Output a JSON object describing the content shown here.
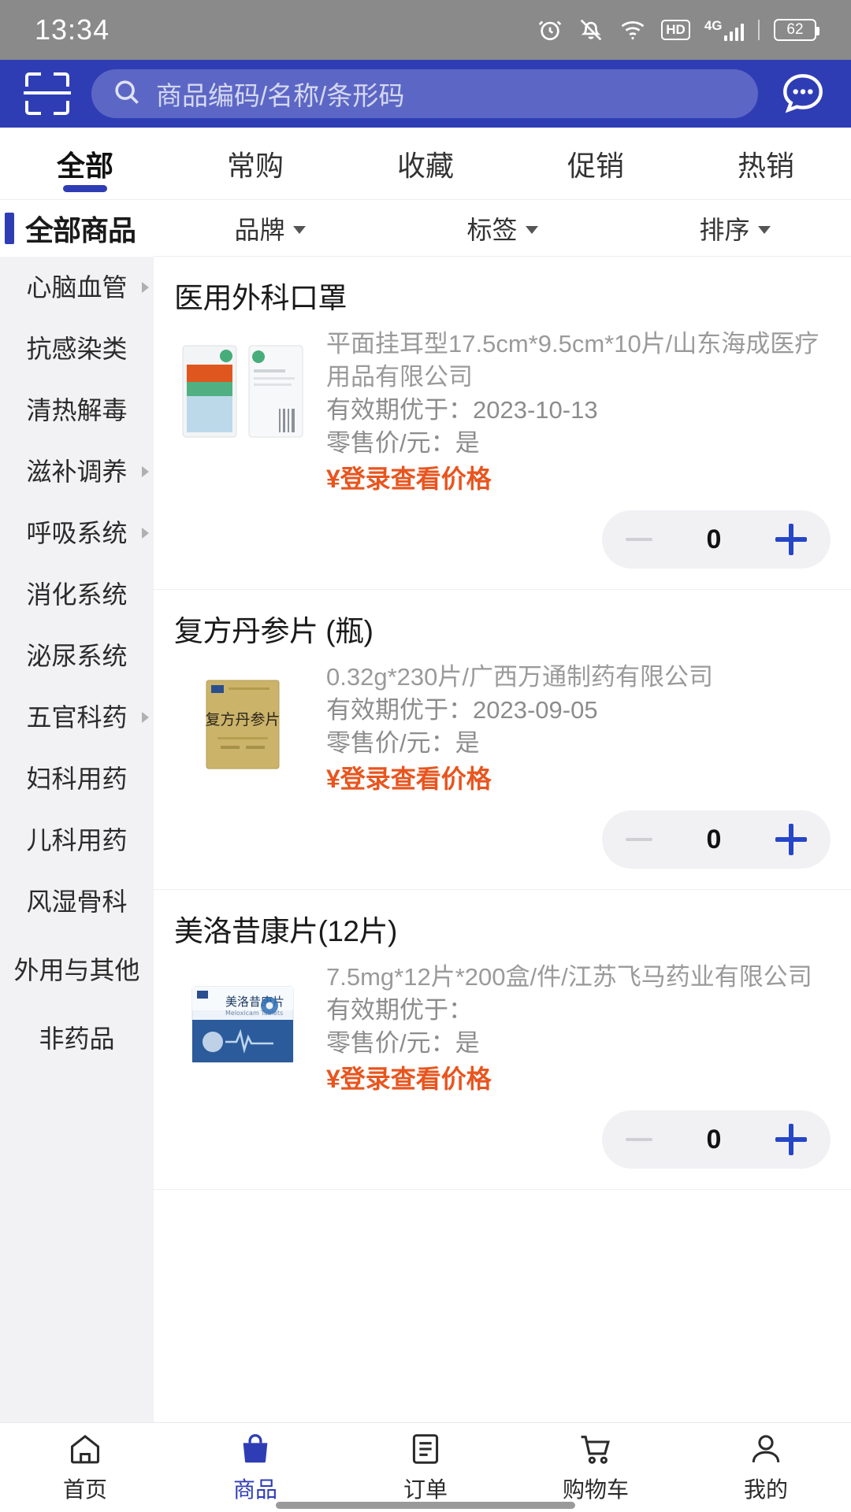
{
  "status_bar": {
    "time": "13:34",
    "battery_level": "62",
    "network_type": "4G",
    "hd_label": "HD",
    "icons": [
      "alarm-icon",
      "mute-icon",
      "wifi-icon",
      "hd-icon",
      "signal-icon",
      "battery-icon"
    ]
  },
  "header": {
    "scan_icon": "scan-barcode-icon",
    "search_placeholder": "商品编码/名称/条形码",
    "search_value": "",
    "search_icon": "search-icon",
    "more_icon": "chat-dots-icon",
    "brand_color": "#2f3db5"
  },
  "tabs": [
    {
      "label": "全部",
      "active": true
    },
    {
      "label": "常购",
      "active": false
    },
    {
      "label": "收藏",
      "active": false
    },
    {
      "label": "促销",
      "active": false
    },
    {
      "label": "热销",
      "active": false
    }
  ],
  "sidebar": {
    "header": "全部商品",
    "items": [
      {
        "label": "心脑血管",
        "has_children": true
      },
      {
        "label": "抗感染类",
        "has_children": false
      },
      {
        "label": "清热解毒",
        "has_children": false
      },
      {
        "label": "滋补调养",
        "has_children": true
      },
      {
        "label": "呼吸系统",
        "has_children": true
      },
      {
        "label": "消化系统",
        "has_children": false
      },
      {
        "label": "泌尿系统",
        "has_children": false
      },
      {
        "label": "五官科药",
        "has_children": true
      },
      {
        "label": "妇科用药",
        "has_children": false
      },
      {
        "label": "儿科用药",
        "has_children": false
      },
      {
        "label": "风湿骨科",
        "has_children": false
      },
      {
        "label": "外用与其他",
        "has_children": false
      },
      {
        "label": "非药品",
        "has_children": false
      }
    ]
  },
  "filters": [
    {
      "label": "品牌",
      "icon": "chevron-down-icon"
    },
    {
      "label": "标签",
      "icon": "chevron-down-icon"
    },
    {
      "label": "排序",
      "icon": "chevron-down-icon"
    }
  ],
  "products": [
    {
      "title": "医用外科口罩",
      "spec": "平面挂耳型17.5cm*9.5cm*10片/山东海成医疗用品有限公司",
      "expiry_label": "有效期优于：",
      "expiry_value": "2023-10-13",
      "retail_label": "零售价/元：",
      "retail_value": "是",
      "price_text": "¥登录查看价格",
      "quantity": "0",
      "image_alt": "医用外科口罩包装袋"
    },
    {
      "title": "复方丹参片 (瓶)",
      "spec": "0.32g*230片/广西万通制药有限公司",
      "expiry_label": "有效期优于：",
      "expiry_value": "2023-09-05",
      "retail_label": "零售价/元：",
      "retail_value": "是",
      "price_text": "¥登录查看价格",
      "quantity": "0",
      "image_alt": "复方丹参片纸盒"
    },
    {
      "title": "美洛昔康片(12片)",
      "spec": "7.5mg*12片*200盒/件/江苏飞马药业有限公司",
      "expiry_label": "有效期优于：",
      "expiry_value": "",
      "retail_label": "零售价/元：",
      "retail_value": "是",
      "price_text": "¥登录查看价格",
      "quantity": "0",
      "image_alt": "美洛昔康片纸盒"
    }
  ],
  "stepper": {
    "minus_icon": "minus-icon",
    "plus_icon": "plus-icon"
  },
  "bottom_nav": [
    {
      "label": "首页",
      "icon": "home-icon",
      "active": false
    },
    {
      "label": "商品",
      "icon": "bag-icon",
      "active": true
    },
    {
      "label": "订单",
      "icon": "order-list-icon",
      "active": false
    },
    {
      "label": "购物车",
      "icon": "cart-icon",
      "active": false
    },
    {
      "label": "我的",
      "icon": "user-icon",
      "active": false
    }
  ],
  "colors": {
    "accent": "#2f3db5",
    "price": "#e8551f",
    "plus": "#2646c8"
  }
}
